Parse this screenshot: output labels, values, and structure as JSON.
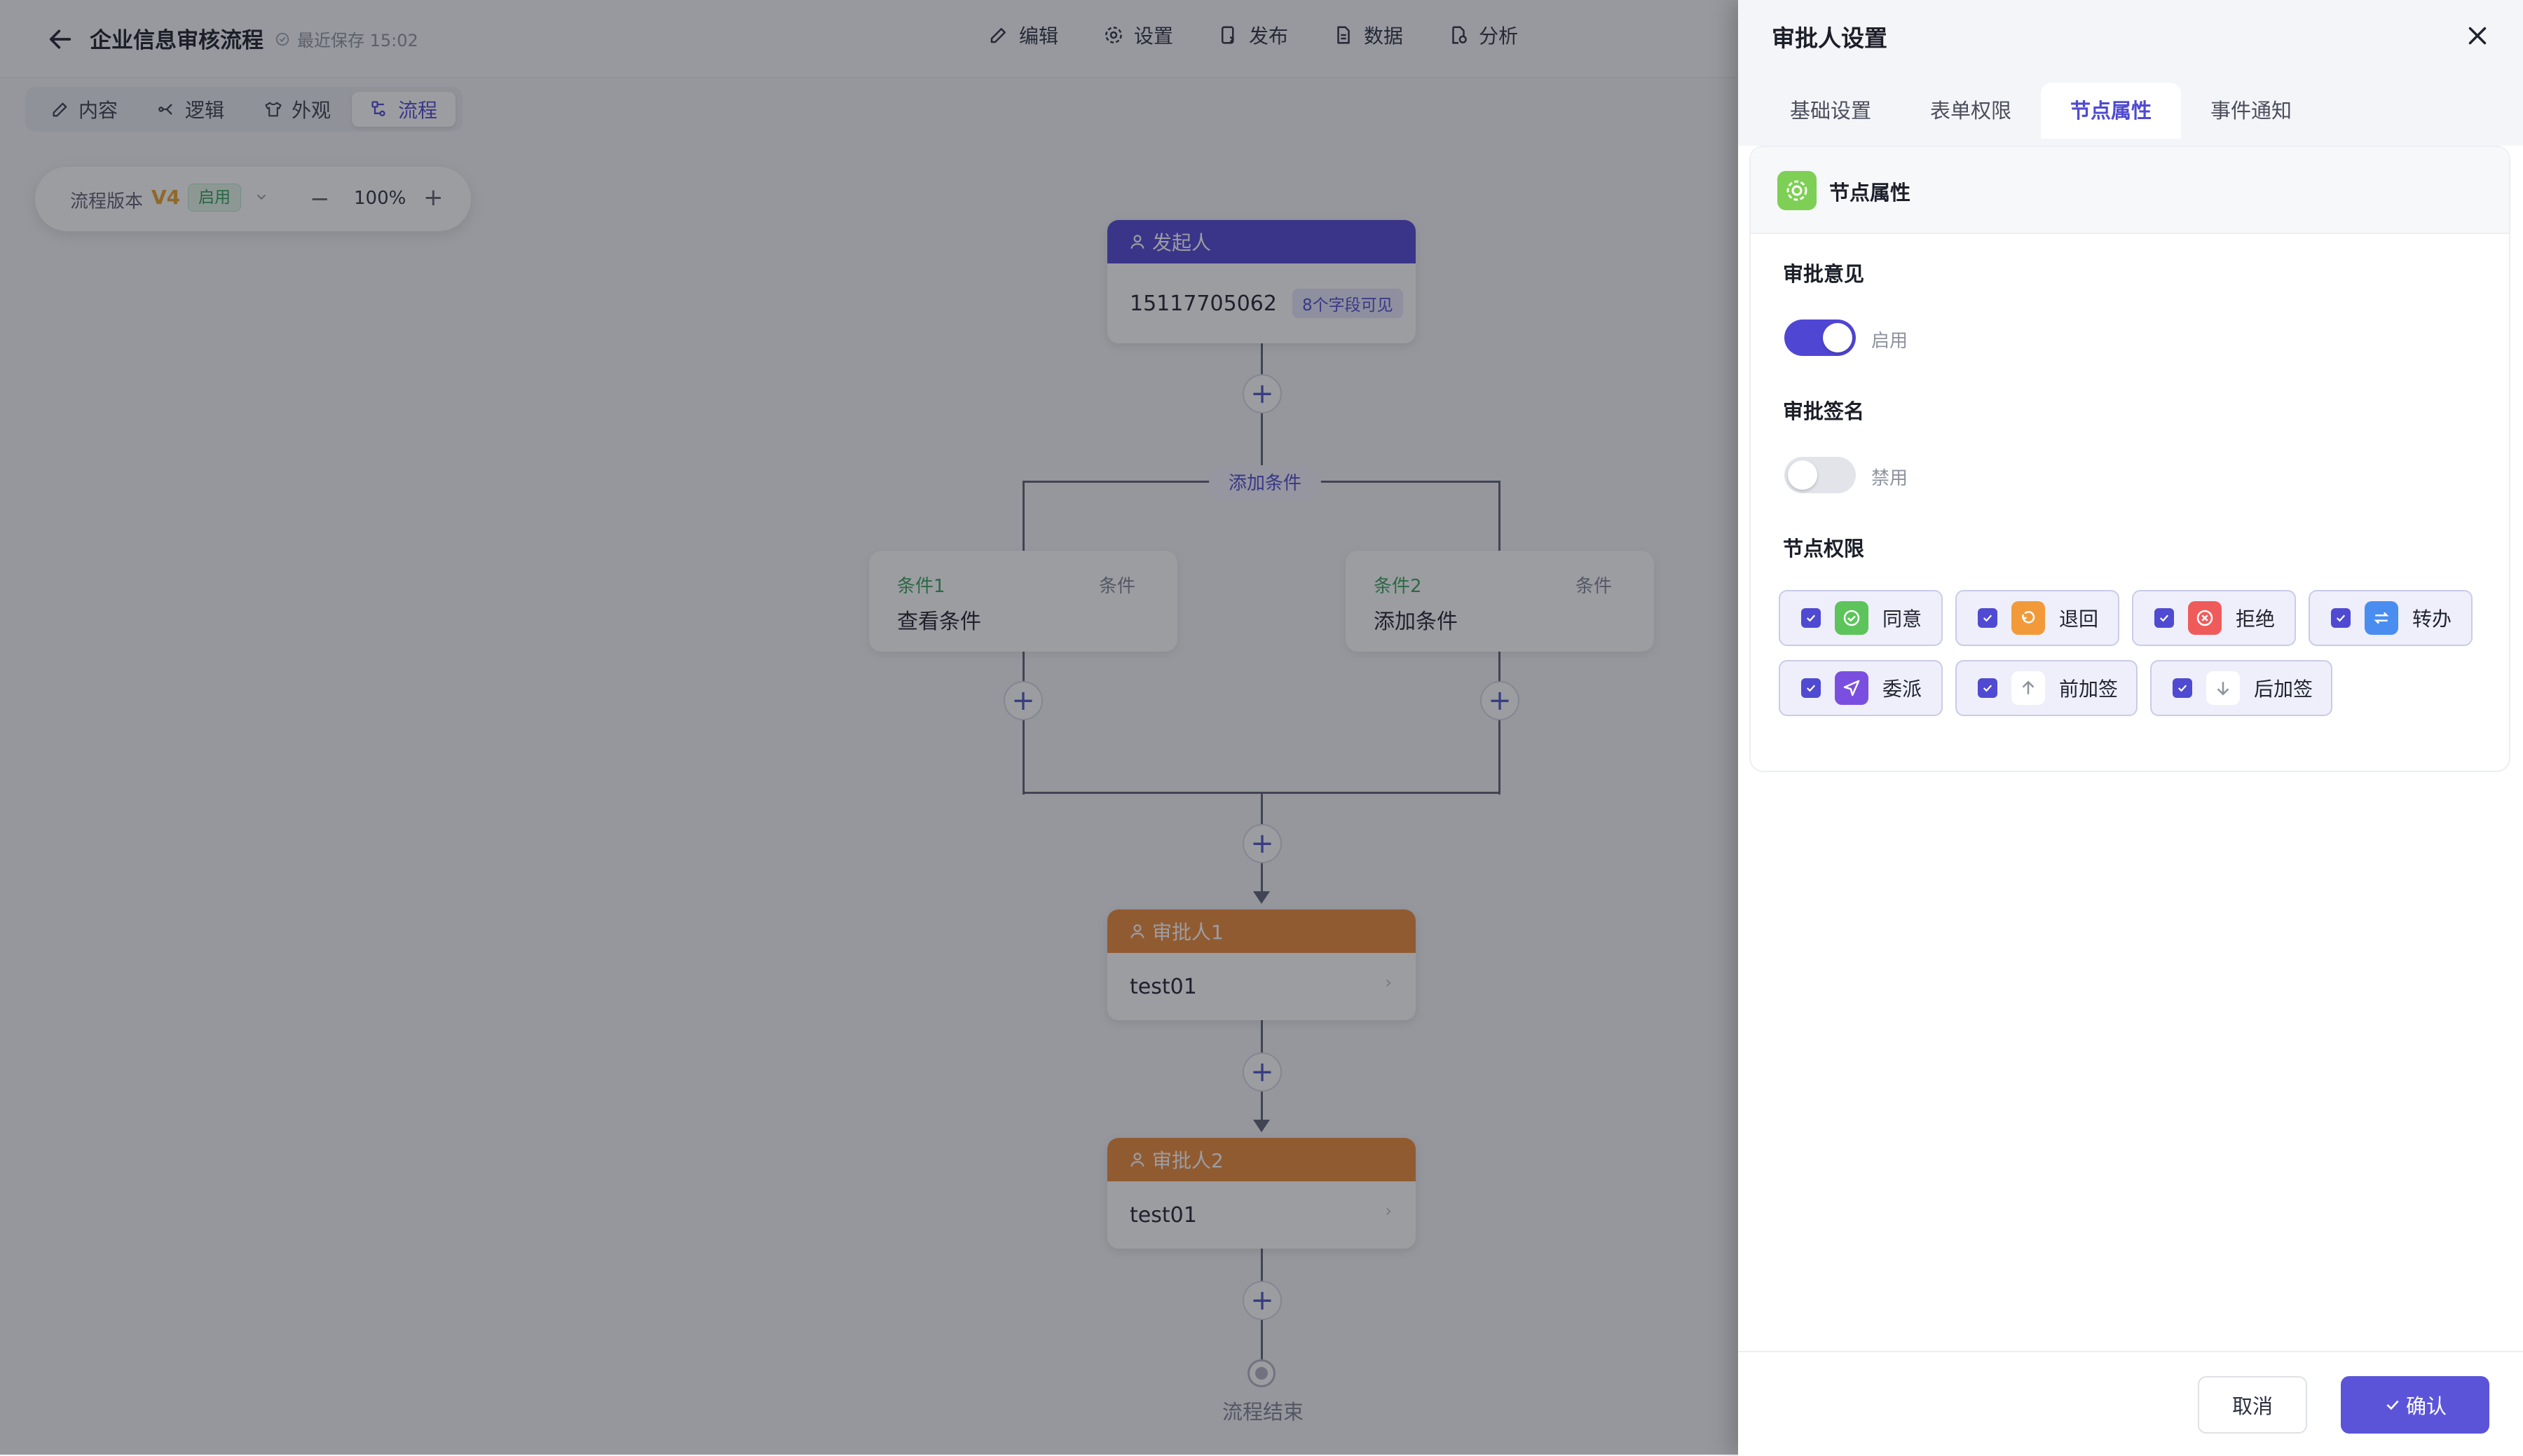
{
  "header": {
    "title": "企业信息审核流程",
    "save_status": "最近保存 15:02",
    "nav": [
      "编辑",
      "设置",
      "发布",
      "数据",
      "分析"
    ]
  },
  "subtabs": [
    "内容",
    "逻辑",
    "外观",
    "流程"
  ],
  "subtabs_active": "流程",
  "version": {
    "label": "流程版本",
    "value": "V4",
    "status": "启用",
    "zoom": "100%"
  },
  "flow": {
    "start_node": {
      "title": "发起人",
      "phone": "15117705062",
      "badge": "8个字段可见"
    },
    "add_condition": "添加条件",
    "conditions": [
      {
        "name": "条件1",
        "type": "条件",
        "desc": "查看条件"
      },
      {
        "name": "条件2",
        "type": "条件",
        "desc": "添加条件"
      }
    ],
    "approvers": [
      {
        "title": "审批人1",
        "value": "test01"
      },
      {
        "title": "审批人2",
        "value": "test01"
      }
    ],
    "end_label": "流程结束"
  },
  "drawer": {
    "title": "审批人设置",
    "tabs": [
      "基础设置",
      "表单权限",
      "节点属性",
      "事件通知"
    ],
    "active_tab": "节点属性",
    "section_title": "节点属性",
    "opinion_label": "审批意见",
    "opinion_on": true,
    "opinion_state": "启用",
    "signature_label": "审批签名",
    "signature_on": false,
    "signature_state": "禁用",
    "permissions_label": "节点权限",
    "permissions": [
      {
        "label": "同意",
        "icon": "check-circle-icon",
        "color": "#5cc45a",
        "checked": true
      },
      {
        "label": "退回",
        "icon": "undo-icon",
        "color": "#f29a3a",
        "checked": true
      },
      {
        "label": "拒绝",
        "icon": "x-circle-icon",
        "color": "#ef5b5b",
        "checked": true
      },
      {
        "label": "转办",
        "icon": "transfer-icon",
        "color": "#4a8df0",
        "checked": true
      },
      {
        "label": "委派",
        "icon": "send-icon",
        "color": "#7a4fe0",
        "checked": true
      },
      {
        "label": "前加签",
        "icon": "arrow-up-icon",
        "color": "#ffffff",
        "checked": true
      },
      {
        "label": "后加签",
        "icon": "arrow-down-icon",
        "color": "#ffffff",
        "checked": true
      }
    ],
    "cancel_label": "取消",
    "confirm_label": "确认"
  }
}
